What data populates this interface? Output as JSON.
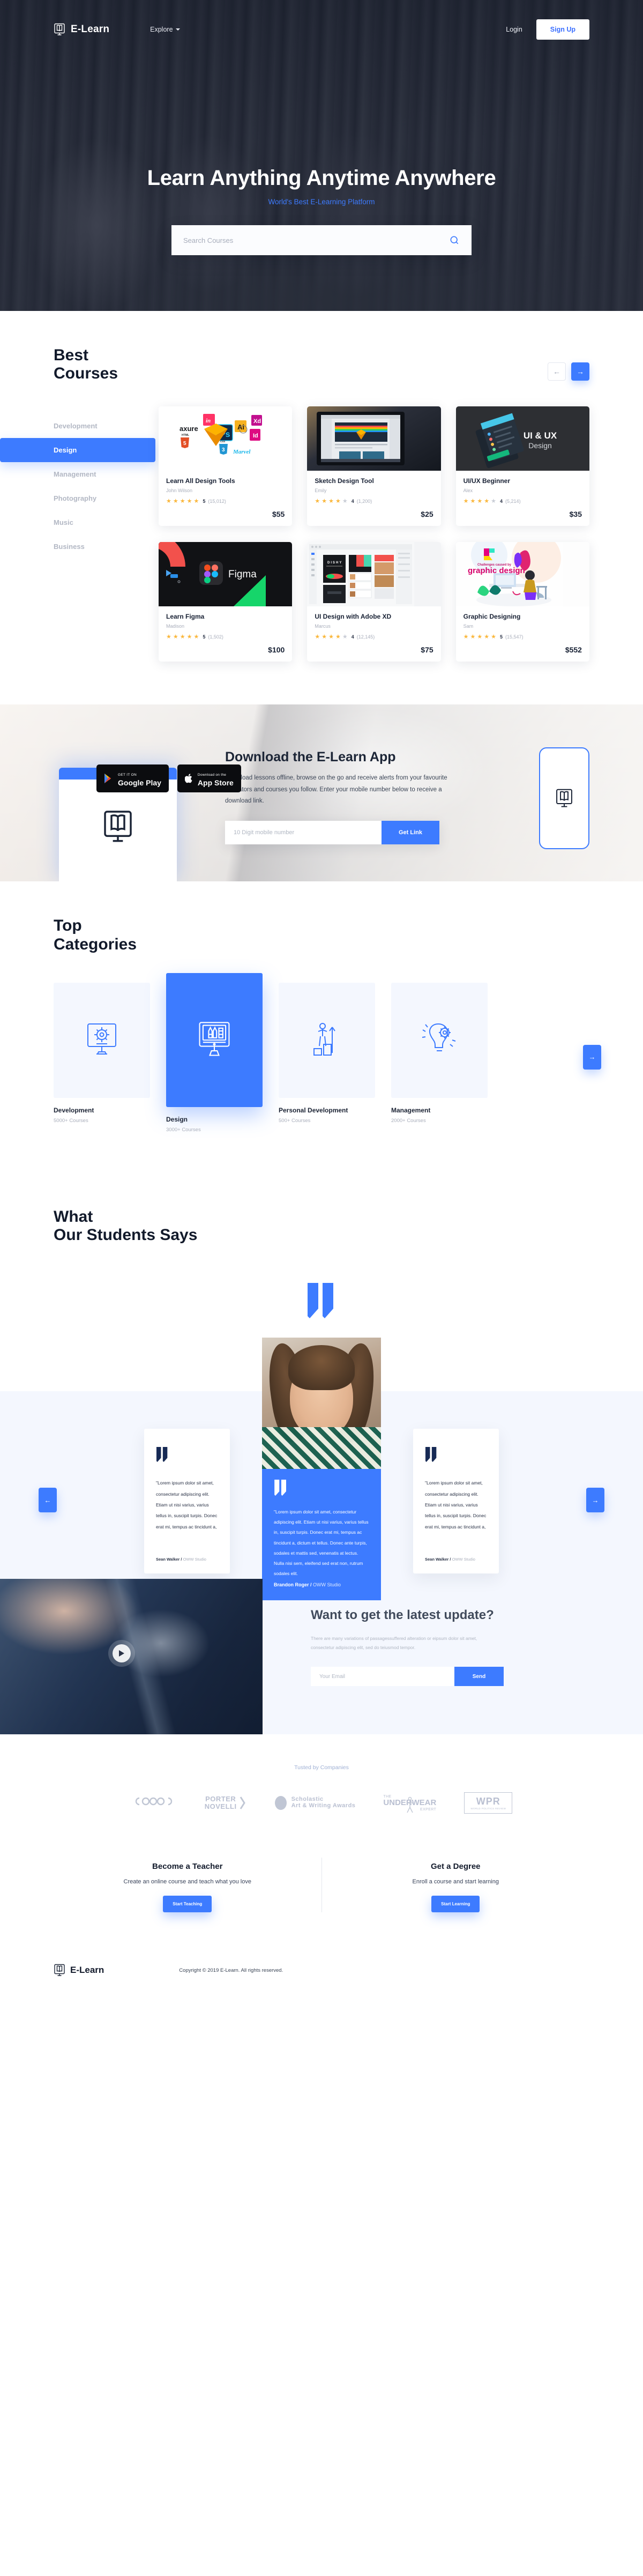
{
  "header": {
    "brand": "E-Learn",
    "brand_icon": "book-monitor-icon",
    "nav": [
      {
        "label": "Explore",
        "icon": "chevron-down-icon"
      }
    ],
    "login_label": "Login",
    "signup_label": "Sign Up"
  },
  "hero": {
    "title": "Learn Anything Anytime Anywhere",
    "subtitle": "World's Best E-Learning Platform",
    "search_placeholder": "Search Courses",
    "search_value": "",
    "search_icon": "search-icon"
  },
  "best_courses": {
    "title_line1": "Best",
    "title_line2": "Courses",
    "prev_icon": "arrow-left-icon",
    "next_icon": "arrow-right-icon",
    "categories": [
      {
        "label": "Development",
        "active": false
      },
      {
        "label": "Design",
        "active": true
      },
      {
        "label": "Management",
        "active": false
      },
      {
        "label": "Photography",
        "active": false
      },
      {
        "label": "Music",
        "active": false
      },
      {
        "label": "Business",
        "active": false
      }
    ],
    "courses": [
      {
        "title": "Learn All Design Tools",
        "author": "John Wilson",
        "rating": 5,
        "rating_label": "5",
        "reviews": "(15,012)",
        "price": "$55",
        "thumb": "design-tools-logos"
      },
      {
        "title": "Sketch Design Tool",
        "author": "Emily",
        "rating": 4,
        "rating_label": "4",
        "reviews": "(1,200)",
        "price": "$25",
        "thumb": "laptop-sketch-screenshot"
      },
      {
        "title": "UI/UX Beginner",
        "author": "Alex",
        "rating": 4,
        "rating_label": "4",
        "reviews": "(5,214)",
        "price": "$35",
        "thumb": "ui-ux-design-dark"
      },
      {
        "title": "Learn Figma",
        "author": "Madison",
        "rating": 5,
        "rating_label": "5",
        "reviews": "(1,502)",
        "price": "$100",
        "thumb": "figma-logo-dark"
      },
      {
        "title": "UI Design with Adobe XD",
        "author": "Marcus",
        "rating": 4,
        "rating_label": "4",
        "reviews": "(12,145)",
        "price": "$75",
        "thumb": "adobe-xd-workspace"
      },
      {
        "title": "Graphic Designing",
        "author": "Sam",
        "rating": 5,
        "rating_label": "5",
        "reviews": "(15,547)",
        "price": "$552",
        "thumb": "graphic-design-illustration"
      }
    ],
    "thumb_labels": {
      "uiux_line1": "UI & UX",
      "uiux_line2": "Design",
      "figma": "Figma",
      "graphic_small": "Challenges caused by",
      "graphic_big": "graphic design",
      "axure": "axure",
      "html5": "HTML 5",
      "css3": "CSS 3",
      "marvel": "Marvel"
    }
  },
  "download_app": {
    "google_play_small": "GET IT ON",
    "google_play_large": "Google Play",
    "app_store_small": "Download on the",
    "app_store_large": "App Store",
    "title": "Download the E-Learn App",
    "description": "Download lessons offline, browse on the go and receive alerts from your favourite educators and courses you follow. Enter your mobile number below to receive a download link.",
    "input_placeholder": "10 Digit mobile number",
    "input_value": "",
    "button_label": "Get Link",
    "phone_icon": "book-monitor-icon",
    "monitor_icon": "book-monitor-icon"
  },
  "top_categories": {
    "title_line1": "Top",
    "title_line2": "Categories",
    "next_icon": "arrow-right-icon",
    "items": [
      {
        "name": "Development",
        "count": "5000+ Courses",
        "icon": "monitor-gear-icon",
        "featured": false
      },
      {
        "name": "Design",
        "count": "3000+ Courses",
        "icon": "monitor-pen-tool-icon",
        "featured": true
      },
      {
        "name": "Personal Development",
        "count": "500+ Courses",
        "icon": "person-growth-icon",
        "featured": false
      },
      {
        "name": "Management",
        "count": "2000+ Courses",
        "icon": "brain-gear-icon",
        "featured": false
      }
    ]
  },
  "testimonials": {
    "title_line1": "What",
    "title_line2": "Our Students Says",
    "quote_icon": "quote-mark-icon",
    "prev_icon": "arrow-left-icon",
    "next_icon": "arrow-right-icon",
    "left": {
      "text": "\"Lorem ipsum dolor sit amet, consectetur adipiscing elit. Etiam ut nisi varius, varius tellus in, suscipit turpis. Donec erat mi, tempus ac tincidunt a,",
      "name": "Sean Walker /",
      "company": "OWW Studio"
    },
    "center": {
      "text": "\"Lorem ipsum dolor sit amet, consectetur adipiscing elit. Etiam ut nisi varius, varius tellus in, suscipit turpis. Donec erat mi, tempus ac tincidunt a, dictum et tellus. Donec ante turpis, sodales et mattis sed, venenatis at lectus. Nulla nisi sem, eleifend sed erat non, rutrum sodales elit.",
      "name": "Brandon Roger /",
      "company": "OWW Studio"
    },
    "right": {
      "text": "\"Lorem ipsum dolor sit amet, consectetur adipiscing elit. Etiam ut nisi varius, varius tellus in, suscipit turpis. Donec erat mi, tempus ac tincidunt a,",
      "name": "Sean Walker /",
      "company": "OWW Studio"
    }
  },
  "newsletter": {
    "play_icon": "play-icon",
    "title": "Want to get the latest update?",
    "description": "There are many variations of passagessuffered alteration or eipsum dolor sit amet, consectetur adipiscing elit, sed do teiusmod tempor.",
    "input_placeholder": "Your Email",
    "input_value": "",
    "button_label": "Send"
  },
  "trusted": {
    "label": "Tusted by Companies",
    "logos": [
      {
        "name": "ceros",
        "line1": "ceros",
        "line2": ""
      },
      {
        "name": "porter-novelli",
        "line1": "PORTER",
        "line2": "NOVELLI"
      },
      {
        "name": "scholastic-art-writing-awards",
        "line1": "Scholastic",
        "line2": "Art & Writing Awards"
      },
      {
        "name": "the-underwear-expert",
        "line1": "UNDERWEAR",
        "line2": "THE / EXPERT"
      },
      {
        "name": "wpr",
        "line1": "WPR",
        "line2": "WORLD POLITICS REVIEW"
      }
    ]
  },
  "cta": {
    "teacher": {
      "title": "Become a Teacher",
      "description": "Create an online course and teach what you love",
      "button_label": "Start Teaching"
    },
    "degree": {
      "title": "Get a Degree",
      "description": "Enroll a course and start learning",
      "button_label": "Start Learning"
    }
  },
  "footer": {
    "brand": "E-Learn",
    "brand_icon": "book-monitor-icon",
    "copyright": "Copyright © 2019 E-Learn. All rights reserved."
  },
  "colors": {
    "accent": "#3d7bff",
    "dark": "#121a2b",
    "muted": "#a9aebb",
    "light_bg": "#f4f7fe",
    "star": "#fab73c"
  }
}
